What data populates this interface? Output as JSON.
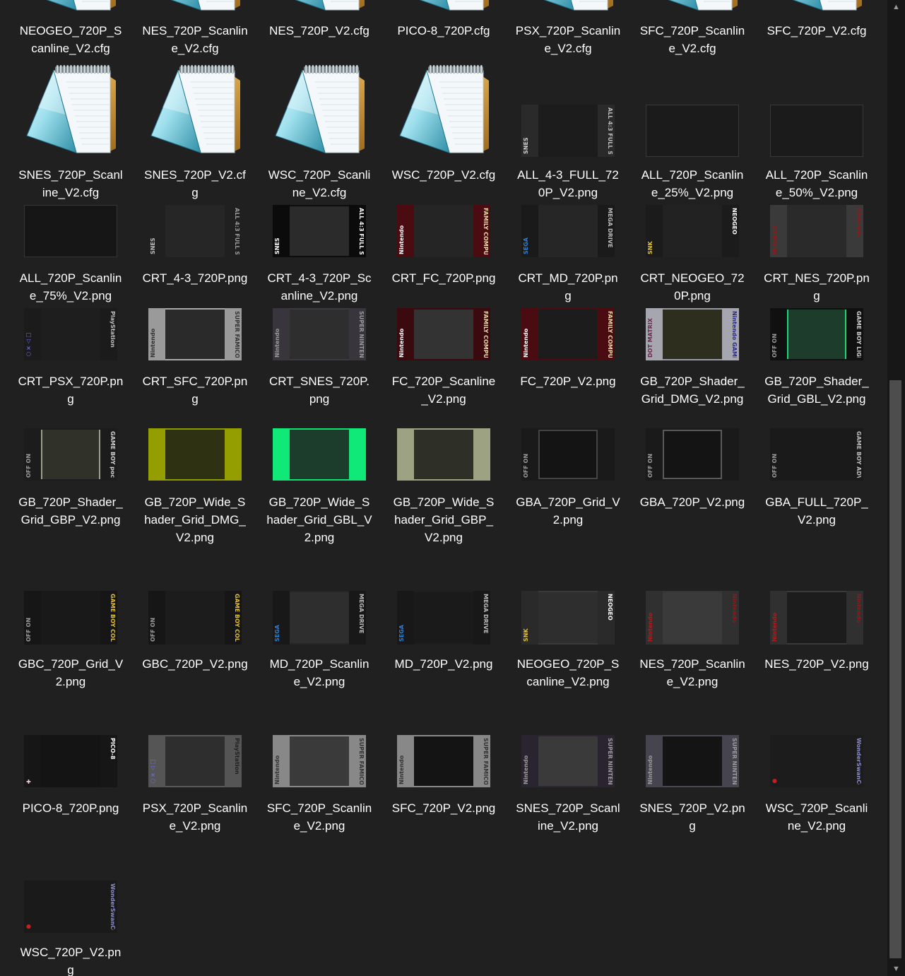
{
  "files": [
    {
      "name": "NEOGEO_720P_Scanline_V2.cfg",
      "kind": "cfg"
    },
    {
      "name": "NES_720P_Scanline_V2.cfg",
      "kind": "cfg"
    },
    {
      "name": "NES_720P_V2.cfg",
      "kind": "cfg"
    },
    {
      "name": "PICO-8_720P.cfg",
      "kind": "cfg"
    },
    {
      "name": "PSX_720P_Scanline_V2.cfg",
      "kind": "cfg"
    },
    {
      "name": "SFC_720P_Scanline_V2.cfg",
      "kind": "cfg"
    },
    {
      "name": "SFC_720P_V2.cfg",
      "kind": "cfg"
    },
    {
      "name": "SNES_720P_Scanline_V2.cfg",
      "kind": "cfg"
    },
    {
      "name": "SNES_720P_V2.cfg",
      "kind": "cfg"
    },
    {
      "name": "WSC_720P_Scanline_V2.cfg",
      "kind": "cfg"
    },
    {
      "name": "WSC_720P_V2.cfg",
      "kind": "cfg"
    },
    {
      "name": "ALL_4-3_FULL_720P_V2.png",
      "kind": "png",
      "art": {
        "bg": "#1c1c1c",
        "left": "#2a2a2a",
        "right": "#2a2a2a",
        "lt": "SNES",
        "rt": "ALL 4:3 FULL SCREEN",
        "ltc": "#cfcfcf",
        "rtc": "#bdbdbd"
      }
    },
    {
      "name": "ALL_720P_Scanline_25%_V2.png",
      "kind": "png",
      "art": {
        "bg": "#1b1b1b",
        "frame": "#3a3a3a"
      }
    },
    {
      "name": "ALL_720P_Scanline_50%_V2.png",
      "kind": "png",
      "art": {
        "bg": "#1b1b1b",
        "frame": "#3a3a3a"
      }
    },
    {
      "name": "ALL_720P_Scanline_75%_V2.png",
      "kind": "png",
      "art": {
        "bg": "#161616",
        "frame": "#353535"
      }
    },
    {
      "name": "CRT_4-3_720P.png",
      "kind": "png",
      "art": {
        "bg": "#262626",
        "left": "#202020",
        "right": "#202020",
        "lt": "SNES",
        "rt": "ALL 4:3 FULL SCREEN",
        "ltc": "#bdbdbd",
        "rtc": "#9a9a9a"
      }
    },
    {
      "name": "CRT_4-3_720P_Scanline_V2.png",
      "kind": "png",
      "art": {
        "bg": "#0d0d0d",
        "left": "#0b0b0b",
        "right": "#0b0b0b",
        "screen": "#2b2b2b",
        "lt": "SNES",
        "rt": "ALL 4:3 FULL SCREEN",
        "ltc": "#ffffff",
        "rtc": "#ffffff"
      }
    },
    {
      "name": "CRT_FC_720P.png",
      "kind": "png",
      "art": {
        "bg": "#252525",
        "left": "#4a0c10",
        "right": "#4a0c10",
        "lt": "Nintendo",
        "rt": "FAMILY COMPUTER",
        "ltc": "#ffffff",
        "rtc": "#e7d9a9"
      }
    },
    {
      "name": "CRT_MD_720P.png",
      "kind": "png",
      "art": {
        "bg": "#262626",
        "left": "#1a1a1a",
        "right": "#1a1a1a",
        "lt": "SEGA",
        "rt": "MEGA DRIVE",
        "ltc": "#2f7fd6",
        "rtc": "#bdbdbd"
      }
    },
    {
      "name": "CRT_NEOGEO_720P.png",
      "kind": "png",
      "art": {
        "bg": "#222222",
        "left": "#1b1b1b",
        "right": "#1b1b1b",
        "lt": "SNK",
        "rt": "NEOGEO",
        "ltc": "#e0c03a",
        "rtc": "#ffffff"
      }
    },
    {
      "name": "CRT_NES_720P.png",
      "kind": "png",
      "art": {
        "bg": "#2a2a2a",
        "left": "#3a3a3a",
        "right": "#3a3a3a",
        "lt": "Nintendo",
        "rt": "Nintendo",
        "ltc": "#8a1c1c",
        "rtc": "#8a1c1c"
      }
    },
    {
      "name": "CRT_PSX_720P.png",
      "kind": "png",
      "art": {
        "bg": "#1e1e1e",
        "left": "#1b1b1b",
        "right": "#1b1b1b",
        "lt": "○×△□",
        "rt": "PlayStation",
        "ltc": "#6f6fe0",
        "rtc": "#bdbdbd"
      }
    },
    {
      "name": "CRT_SFC_720P.png",
      "kind": "png",
      "art": {
        "bg": "#a9a9a9",
        "left": "#9a9a9a",
        "right": "#9a9a9a",
        "screen": "#2a2a2a",
        "lt": "Nintendo",
        "rt": "SUPER FAMICOM",
        "ltc": "#333333",
        "rtc": "#333333"
      }
    },
    {
      "name": "CRT_SNES_720P.png",
      "kind": "png",
      "art": {
        "bg": "#3c3a40",
        "left": "#38363c",
        "right": "#38363c",
        "screen": "#2e2e2e",
        "lt": "Nintendo",
        "rt": "SUPER NINTENDO",
        "ltc": "#9a9a9a",
        "rtc": "#9a9a9a"
      }
    },
    {
      "name": "FC_720P_Scanline_V2.png",
      "kind": "png",
      "art": {
        "bg": "#3a0a0e",
        "left": "#3a0a0e",
        "right": "#3a0a0e",
        "screen": "#333333",
        "lt": "Nintendo",
        "rt": "FAMILY COMPUTER",
        "ltc": "#ffffff",
        "rtc": "#e7d9a9"
      }
    },
    {
      "name": "FC_720P_V2.png",
      "kind": "png",
      "art": {
        "bg": "#4a0c10",
        "left": "#4a0c10",
        "right": "#4a0c10",
        "screen": "#1c1c1c",
        "lt": "Nintendo",
        "rt": "FAMILY COMPUTER",
        "ltc": "#ffffff",
        "rtc": "#e7d9a9"
      }
    },
    {
      "name": "GB_720P_Shader_Grid_DMG_V2.png",
      "kind": "png",
      "art": {
        "bg": "#9a9aa6",
        "left": "#a6a6b0",
        "right": "#a6a6b0",
        "screen": "#2e2e1e",
        "lt": "DOT MATRIX",
        "rt": "Nintendo GAME BOY",
        "ltc": "#6a2a4a",
        "rtc": "#2a2a8a"
      }
    },
    {
      "name": "GB_720P_Shader_Grid_GBL_V2.png",
      "kind": "png",
      "art": {
        "bg": "#101010",
        "left": "#101010",
        "right": "#101010",
        "screen": "#1e3c2c",
        "screenEdge": "#18d878",
        "lt": "OFF ON",
        "rt": "GAME BOY LIGHT",
        "ltc": "#9a9a9a",
        "rtc": "#cfcfcf"
      }
    },
    {
      "name": "GB_720P_Shader_Grid_GBP_V2.png",
      "kind": "png",
      "art": {
        "bg": "#1c1c1c",
        "left": "#1c1c1c",
        "right": "#1c1c1c",
        "screen": "#30322a",
        "screenEdge": "#9aa08a",
        "lt": "OFF ON",
        "rt": "GAME BOY pocket",
        "ltc": "#9a9a9a",
        "rtc": "#cfcfcf"
      }
    },
    {
      "name": "GB_720P_Wide_Shader_Grid_DMG_V2.png",
      "kind": "png",
      "art": {
        "bg": "#8a9a00",
        "left": "#949e00",
        "right": "#949e00",
        "screen": "#2e3212"
      }
    },
    {
      "name": "GB_720P_Wide_Shader_Grid_GBL_V2.png",
      "kind": "png",
      "art": {
        "bg": "#10e070",
        "left": "#10e878",
        "right": "#10e878",
        "screen": "#1c3c2c"
      }
    },
    {
      "name": "GB_720P_Wide_Shader_Grid_GBP_V2.png",
      "kind": "png",
      "art": {
        "bg": "#9aa080",
        "left": "#9ca282",
        "right": "#9ca282",
        "screen": "#2e3028"
      }
    },
    {
      "name": "GBA_720P_Grid_V2.png",
      "kind": "png",
      "art": {
        "bg": "#1a1a1a",
        "left": "#1a1a1a",
        "right": "#1a1a1a",
        "screen": "#141414",
        "frame": "#444444",
        "lt": "OFF ON",
        "ltc": "#9a9a9a"
      }
    },
    {
      "name": "GBA_720P_V2.png",
      "kind": "png",
      "art": {
        "bg": "#1a1a1a",
        "left": "#1a1a1a",
        "right": "#1a1a1a",
        "screen": "#141414",
        "frame": "#5a5a5a",
        "lt": "OFF ON",
        "ltc": "#9a9a9a"
      }
    },
    {
      "name": "GBA_FULL_720P_V2.png",
      "kind": "png",
      "art": {
        "bg": "#1a1a1a",
        "left": "#1a1a1a",
        "right": "#1a1a1a",
        "lt": "OFF ON",
        "rt": "GAME BOY ADVANCE",
        "ltc": "#9a9a9a",
        "rtc": "#bdbdbd"
      }
    },
    {
      "name": "GBC_720P_Grid_V2.png",
      "kind": "png",
      "art": {
        "bg": "#191919",
        "left": "#161616",
        "right": "#161616",
        "lt": "OFF ON",
        "rt": "GAME BOY COLOR",
        "ltc": "#9a9a9a",
        "rtc": "#e0c03a"
      }
    },
    {
      "name": "GBC_720P_V2.png",
      "kind": "png",
      "art": {
        "bg": "#1c1c1c",
        "left": "#161616",
        "right": "#161616",
        "lt": "OFF ON",
        "rt": "GAME BOY COLOR",
        "ltc": "#9a9a9a",
        "rtc": "#e0c03a"
      }
    },
    {
      "name": "MD_720P_Scanline_V2.png",
      "kind": "png",
      "art": {
        "bg": "#262626",
        "left": "#181818",
        "right": "#181818",
        "screen": "#2e2e2e",
        "lt": "SEGA",
        "rt": "MEGA DRIVE",
        "ltc": "#2f7fd6",
        "rtc": "#bdbdbd"
      }
    },
    {
      "name": "MD_720P_V2.png",
      "kind": "png",
      "art": {
        "bg": "#1e1e1e",
        "left": "#181818",
        "right": "#181818",
        "screen": "#1a1a1a",
        "lt": "SEGA",
        "rt": "MEGA DRIVE",
        "ltc": "#2f7fd6",
        "rtc": "#bdbdbd"
      }
    },
    {
      "name": "NEOGEO_720P_Scanline_V2.png",
      "kind": "png",
      "art": {
        "bg": "#3a3a3a",
        "left": "#2a2a2a",
        "right": "#2a2a2a",
        "screen": "#2e2e2e",
        "lt": "SNK",
        "rt": "NEOGEO",
        "ltc": "#e0c03a",
        "rtc": "#ffffff"
      }
    },
    {
      "name": "NES_720P_Scanline_V2.png",
      "kind": "png",
      "art": {
        "bg": "#353535",
        "left": "#303030",
        "right": "#303030",
        "screen": "#3a3a3a",
        "lt": "Nintendo",
        "rt": "Nintendo",
        "ltc": "#b01c1c",
        "rtc": "#8a1c1c"
      }
    },
    {
      "name": "NES_720P_V2.png",
      "kind": "png",
      "art": {
        "bg": "#3a3a3a",
        "left": "#303030",
        "right": "#303030",
        "screen": "#1c1c1c",
        "lt": "Nintendo",
        "rt": "Nintendo",
        "ltc": "#b01c1c",
        "rtc": "#8a1c1c"
      }
    },
    {
      "name": "PICO-8_720P.png",
      "kind": "png",
      "art": {
        "bg": "#141414",
        "left": "#161616",
        "right": "#161616",
        "lt": "✚",
        "rt": "PICO-8",
        "ltc": "#f0d0e0",
        "rtc": "#ffffff"
      }
    },
    {
      "name": "PSX_720P_Scanline_V2.png",
      "kind": "png",
      "art": {
        "bg": "#5a5a5a",
        "left": "#555555",
        "right": "#555555",
        "screen": "#2e2e2e",
        "lt": "○×△□",
        "rt": "PlayStation",
        "ltc": "#6f6fe0",
        "rtc": "#222222"
      }
    },
    {
      "name": "SFC_720P_Scanline_V2.png",
      "kind": "png",
      "art": {
        "bg": "#8a8a8a",
        "left": "#888888",
        "right": "#888888",
        "screen": "#3a3a3a",
        "lt": "Nintendo",
        "rt": "SUPER FAMICOM",
        "ltc": "#333333",
        "rtc": "#333333"
      }
    },
    {
      "name": "SFC_720P_V2.png",
      "kind": "png",
      "art": {
        "bg": "#8a8a8a",
        "left": "#888888",
        "right": "#888888",
        "screen": "#141414",
        "lt": "Nintendo",
        "rt": "SUPER FAMICOM",
        "ltc": "#333333",
        "rtc": "#333333"
      }
    },
    {
      "name": "SNES_720P_Scanline_V2.png",
      "kind": "png",
      "art": {
        "bg": "#2e2632",
        "left": "#2a2430",
        "right": "#2a2430",
        "screen": "#3a3a3a",
        "lt": "Nintendo",
        "rt": "SUPER NINTENDO",
        "ltc": "#9a9a9a",
        "rtc": "#9a9a9a"
      }
    },
    {
      "name": "SNES_720P_V2.png",
      "kind": "png",
      "art": {
        "bg": "#4a4852",
        "left": "#46444e",
        "right": "#46444e",
        "screen": "#141414",
        "lt": "Nintendo",
        "rt": "SUPER NINTENDO",
        "ltc": "#9a9a9a",
        "rtc": "#9a9a9a"
      }
    },
    {
      "name": "WSC_720P_Scanline_V2.png",
      "kind": "png",
      "art": {
        "bg": "#1c1c1c",
        "left": "#1c1c1c",
        "right": "#1c1c1c",
        "lt": "●",
        "rt": "WonderSwanColor",
        "ltc": "#c02020",
        "rtc": "#8a8ad0"
      }
    },
    {
      "name": "WSC_720P_V2.png",
      "kind": "png",
      "art": {
        "bg": "#1a1a1a",
        "left": "#1a1a1a",
        "right": "#1a1a1a",
        "lt": "●",
        "rt": "WonderSwanColor",
        "ltc": "#c02020",
        "rtc": "#8a8ad0"
      }
    }
  ],
  "scrollbar": {
    "up": "▲",
    "down": "▼"
  },
  "colors": {
    "background": "#202020",
    "text": "#ffffff",
    "scrollbar_track": "#171717",
    "scrollbar_thumb": "#4d4d4d"
  }
}
